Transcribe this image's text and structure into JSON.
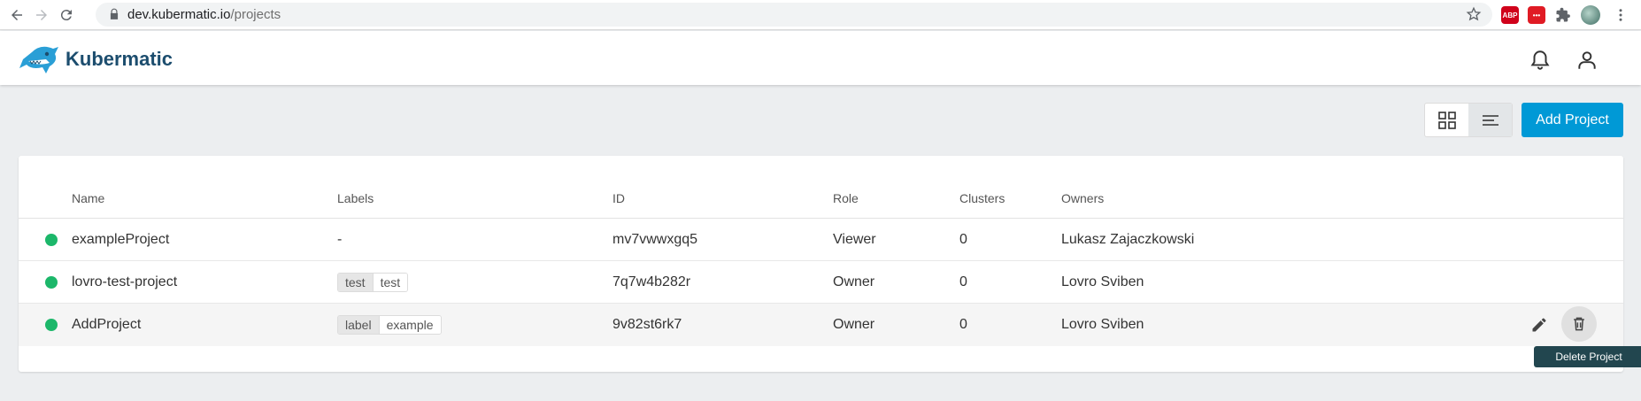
{
  "browser": {
    "url_host": "dev.kubermatic.io",
    "url_path": "/projects",
    "extensions": [
      {
        "name": "adblock-plus-icon",
        "label": "ABP",
        "color": "#d0021b"
      },
      {
        "name": "extension-red-icon",
        "label": "•••",
        "color": "#e01b24"
      }
    ]
  },
  "header": {
    "brand": "Kubermatic"
  },
  "toolbar": {
    "add_project_label": "Add Project"
  },
  "table": {
    "columns": [
      "Name",
      "Labels",
      "ID",
      "Role",
      "Clusters",
      "Owners"
    ],
    "rows": [
      {
        "name": "exampleProject",
        "labels_text": "-",
        "labels": [],
        "id": "mv7vwwxgq5",
        "role": "Viewer",
        "clusters": "0",
        "owners": "Lukasz Zajaczkowski",
        "status_color": "#1cb76a"
      },
      {
        "name": "lovro-test-project",
        "labels_text": "",
        "labels": [
          {
            "key": "test",
            "value": "test"
          }
        ],
        "id": "7q7w4b282r",
        "role": "Owner",
        "clusters": "0",
        "owners": "Lovro Sviben",
        "status_color": "#1cb76a"
      },
      {
        "name": "AddProject",
        "labels_text": "",
        "labels": [
          {
            "key": "label",
            "value": "example"
          }
        ],
        "id": "9v82st6rk7",
        "role": "Owner",
        "clusters": "0",
        "owners": "Lovro Sviben",
        "status_color": "#1cb76a"
      }
    ]
  },
  "tooltip": {
    "text": "Delete Project"
  },
  "colors": {
    "accent": "#0099d6",
    "status_active": "#1cb76a",
    "tooltip_bg": "#22464f"
  }
}
